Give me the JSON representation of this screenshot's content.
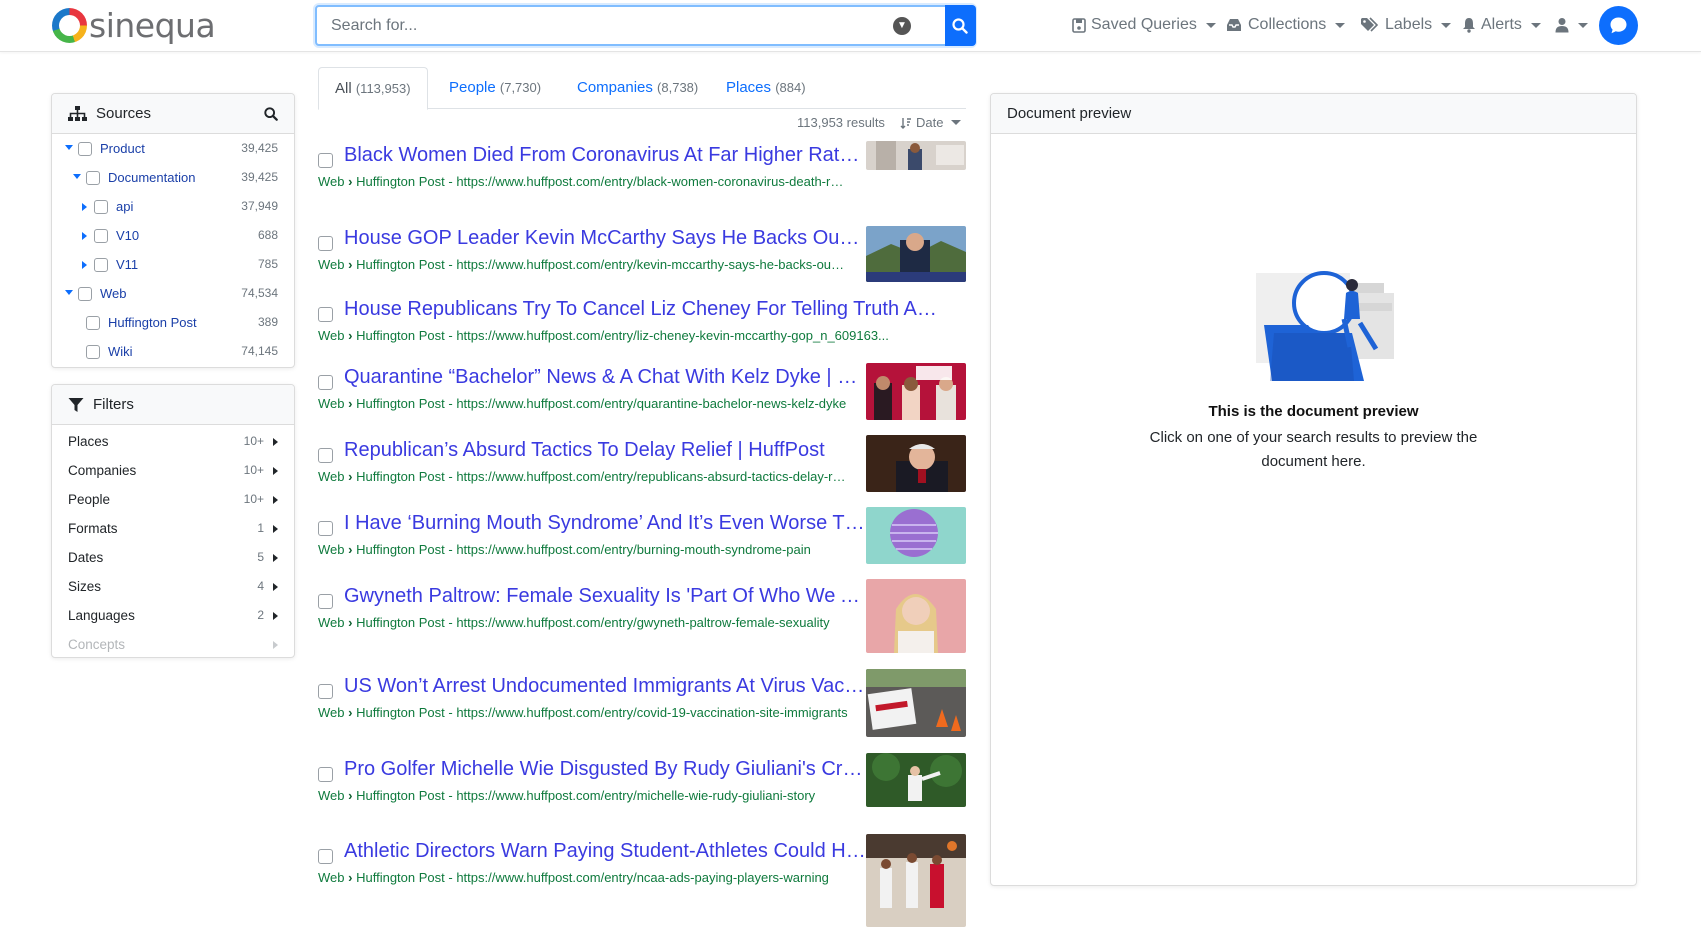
{
  "app": {
    "logo_text": "sinequa"
  },
  "search": {
    "placeholder": "Search for..."
  },
  "nav": {
    "saved_queries": "Saved Queries",
    "collections": "Collections",
    "labels": "Labels",
    "alerts": "Alerts"
  },
  "sources": {
    "title": "Sources",
    "items": [
      {
        "label": "Product",
        "count": "39,425"
      },
      {
        "label": "Documentation",
        "count": "39,425"
      },
      {
        "label": "api",
        "count": "37,949"
      },
      {
        "label": "V10",
        "count": "688"
      },
      {
        "label": "V11",
        "count": "785"
      },
      {
        "label": "Web",
        "count": "74,534"
      },
      {
        "label": "Huffington Post",
        "count": "389"
      },
      {
        "label": "Wiki",
        "count": "74,145"
      }
    ]
  },
  "filters": {
    "title": "Filters",
    "items": [
      {
        "label": "Places",
        "count": "10+"
      },
      {
        "label": "Companies",
        "count": "10+"
      },
      {
        "label": "People",
        "count": "10+"
      },
      {
        "label": "Formats",
        "count": "1"
      },
      {
        "label": "Dates",
        "count": "5"
      },
      {
        "label": "Sizes",
        "count": "4"
      },
      {
        "label": "Languages",
        "count": "2"
      },
      {
        "label": "Concepts",
        "count": ""
      }
    ]
  },
  "tabs": [
    {
      "label": "All",
      "count": "(113,953)"
    },
    {
      "label": "People",
      "count": "(7,730)"
    },
    {
      "label": "Companies",
      "count": "(8,738)"
    },
    {
      "label": "Places",
      "count": "(884)"
    }
  ],
  "results_meta": {
    "count": "113,953 results",
    "sort": "Date"
  },
  "results": [
    {
      "title": "Black Women Died From Coronavirus At Far Higher Rates Than White Men",
      "source": "Web",
      "collection": "Huffington Post",
      "url": "https://www.huffpost.com/entry/black-women-coronavirus-death-rates"
    },
    {
      "title": "House GOP Leader Kevin McCarthy Says He Backs Ousting Liz Cheney",
      "source": "Web",
      "collection": "Huffington Post",
      "url": "https://www.huffpost.com/entry/kevin-mccarthy-says-he-backs-ousting-liz-cheney"
    },
    {
      "title": "House Republicans Try To Cancel Liz Cheney For Telling Truth About Trump",
      "source": "Web",
      "collection": "Huffington Post",
      "url": "https://www.huffpost.com/entry/liz-cheney-kevin-mccarthy-gop_n_609163..."
    },
    {
      "title": "Quarantine “Bachelor” News & A Chat With Kelz Dyke | HuffPost",
      "source": "Web",
      "collection": "Huffington Post",
      "url": "https://www.huffpost.com/entry/quarantine-bachelor-news-kelz-dyke"
    },
    {
      "title": "Republican’s Absurd Tactics To Delay Relief | HuffPost",
      "source": "Web",
      "collection": "Huffington Post",
      "url": "https://www.huffpost.com/entry/republicans-absurd-tactics-delay-relief"
    },
    {
      "title": "I Have ‘Burning Mouth Syndrome’ And It’s Even Worse Than It Sounds",
      "source": "Web",
      "collection": "Huffington Post",
      "url": "https://www.huffpost.com/entry/burning-mouth-syndrome-pain"
    },
    {
      "title": "Gwyneth Paltrow: Female Sexuality Is 'Part Of Who We Are'",
      "source": "Web",
      "collection": "Huffington Post",
      "url": "https://www.huffpost.com/entry/gwyneth-paltrow-female-sexuality"
    },
    {
      "title": "US Won’t Arrest Undocumented Immigrants At Virus Vaccination Sites",
      "source": "Web",
      "collection": "Huffington Post",
      "url": "https://www.huffpost.com/entry/covid-19-vaccination-site-immigrants"
    },
    {
      "title": "Pro Golfer Michelle Wie Disgusted By Rudy Giuliani's Crude Story",
      "source": "Web",
      "collection": "Huffington Post",
      "url": "https://www.huffpost.com/entry/michelle-wie-rudy-giuliani-story"
    },
    {
      "title": "Athletic Directors Warn Paying Student-Athletes Could Hurt Sports",
      "source": "Web",
      "collection": "Huffington Post",
      "url": "https://www.huffpost.com/entry/ncaa-ads-paying-players-warning"
    }
  ],
  "preview": {
    "header": "Document preview",
    "title": "This is the document preview",
    "text": "Click on one of your search results to preview the document here."
  },
  "colors": {
    "accent": "#0d6efd",
    "link": "#3a3ae0",
    "url_green": "#0f7a3d"
  }
}
